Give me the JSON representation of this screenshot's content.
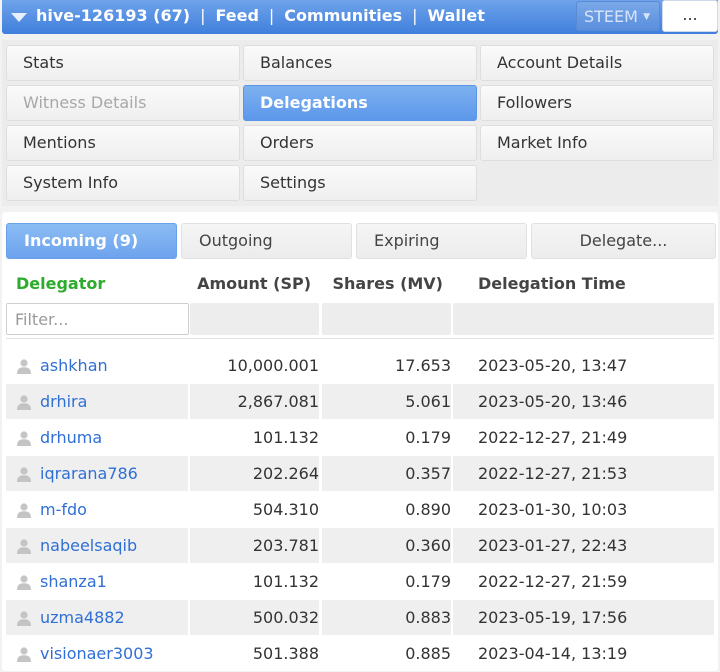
{
  "header": {
    "account": "hive-126193 (67)",
    "nav": [
      "Feed",
      "Communities",
      "Wallet"
    ],
    "separator": "|",
    "currency": "STEEM",
    "more": "..."
  },
  "menu": [
    {
      "label": "Stats",
      "state": "normal"
    },
    {
      "label": "Balances",
      "state": "normal"
    },
    {
      "label": "Account Details",
      "state": "normal"
    },
    {
      "label": "Witness Details",
      "state": "disabled"
    },
    {
      "label": "Delegations",
      "state": "active"
    },
    {
      "label": "Followers",
      "state": "normal"
    },
    {
      "label": "Mentions",
      "state": "normal"
    },
    {
      "label": "Orders",
      "state": "normal"
    },
    {
      "label": "Market Info",
      "state": "normal"
    },
    {
      "label": "System Info",
      "state": "normal"
    },
    {
      "label": "Settings",
      "state": "normal"
    }
  ],
  "tabs": {
    "incoming": "Incoming (9)",
    "outgoing": "Outgoing",
    "expiring": "Expiring",
    "delegate": "Delegate..."
  },
  "table": {
    "headers": {
      "delegator": "Delegator",
      "amount": "Amount (SP)",
      "shares": "Shares (MV)",
      "time": "Delegation Time"
    },
    "filter_placeholder": "Filter...",
    "rows": [
      {
        "delegator": "ashkhan",
        "amount": "10,000.001",
        "shares": "17.653",
        "time": "2023-05-20, 13:47"
      },
      {
        "delegator": "drhira",
        "amount": "2,867.081",
        "shares": "5.061",
        "time": "2023-05-20, 13:46"
      },
      {
        "delegator": "drhuma",
        "amount": "101.132",
        "shares": "0.179",
        "time": "2022-12-27, 21:49"
      },
      {
        "delegator": "iqrarana786",
        "amount": "202.264",
        "shares": "0.357",
        "time": "2022-12-27, 21:53"
      },
      {
        "delegator": "m-fdo",
        "amount": "504.310",
        "shares": "0.890",
        "time": "2023-01-30, 10:03"
      },
      {
        "delegator": "nabeelsaqib",
        "amount": "203.781",
        "shares": "0.360",
        "time": "2023-01-27, 22:43"
      },
      {
        "delegator": "shanza1",
        "amount": "101.132",
        "shares": "0.179",
        "time": "2022-12-27, 21:59"
      },
      {
        "delegator": "uzma4882",
        "amount": "500.032",
        "shares": "0.883",
        "time": "2023-05-19, 17:56"
      },
      {
        "delegator": "visionaer3003",
        "amount": "501.388",
        "shares": "0.885",
        "time": "2023-04-14, 13:19"
      }
    ]
  },
  "colors": {
    "accent": "#4a86e0",
    "delegator_header": "#2cab2c",
    "link": "#2f6fd6"
  }
}
